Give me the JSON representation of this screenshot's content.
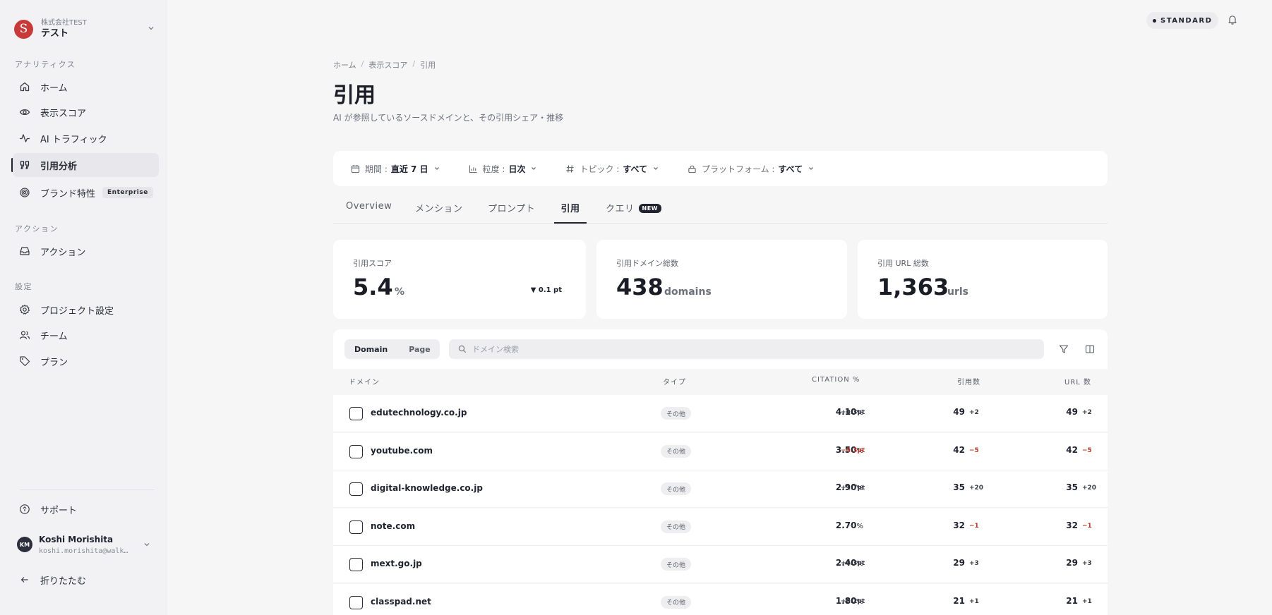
{
  "org": {
    "logo_letter": "S",
    "subtitle": "株式会社TEST",
    "name": "テスト"
  },
  "sidebar": {
    "section_analytics": "アナリティクス",
    "section_actions": "アクション",
    "section_settings": "設定",
    "items": [
      {
        "label": "ホーム",
        "icon": "home-icon"
      },
      {
        "label": "表示スコア",
        "icon": "eye-icon"
      },
      {
        "label": "AI トラフィック",
        "icon": "activity-icon"
      },
      {
        "label": "引用分析",
        "icon": "quote-icon",
        "active": true
      },
      {
        "label": "ブランド特性",
        "icon": "fingerprint-icon",
        "badge": "Enterprise"
      },
      {
        "label": "アクション",
        "icon": "inbox-icon"
      },
      {
        "label": "プロジェクト設定",
        "icon": "gear-icon"
      },
      {
        "label": "チーム",
        "icon": "users-icon"
      },
      {
        "label": "プラン",
        "icon": "tag-icon"
      }
    ],
    "support": "サポート",
    "collapse": "折りたたむ"
  },
  "user": {
    "initials": "KM",
    "name": "Koshi Morishita",
    "email": "koshi.morishita@walker"
  },
  "plan_badge": "STANDARD",
  "breadcrumb": [
    "ホーム",
    "表示スコア",
    "引用"
  ],
  "page": {
    "title": "引用",
    "description": "AI が参照しているソースドメインと、その引用シェア・推移"
  },
  "filters": [
    {
      "label": "期間 :",
      "value": "直近 7 日",
      "icon": "calendar-icon"
    },
    {
      "label": "粒度 :",
      "value": "日次",
      "icon": "chart-icon"
    },
    {
      "label": "トピック :",
      "value": "すべて",
      "icon": "hash-icon"
    },
    {
      "label": "プラットフォーム :",
      "value": "すべて",
      "icon": "lock-icon"
    }
  ],
  "tabs": [
    {
      "label": "Overview"
    },
    {
      "label": "メンション"
    },
    {
      "label": "プロンプト"
    },
    {
      "label": "引用",
      "active": true
    },
    {
      "label": "クエリ",
      "badge": "NEW"
    }
  ],
  "stats": [
    {
      "label": "引用スコア",
      "value": "5.4",
      "unit": "%",
      "delta": "▼ 0.1 pt"
    },
    {
      "label": "引用ドメイン総数",
      "value": "438",
      "unit": "domains"
    },
    {
      "label": "引用 URL 総数",
      "value": "1,363",
      "unit": "urls"
    }
  ],
  "table": {
    "segments": [
      "Domain",
      "Page"
    ],
    "search_placeholder": "ドメイン検索",
    "columns": [
      "ドメイン",
      "タイプ",
      "CITATION %",
      "引用数",
      "URL 数"
    ],
    "rows": [
      {
        "domain": "edutechnology.co.jp",
        "type": "その他",
        "citation": "4.10",
        "citation_delta": "+0.3pt",
        "cites": "49",
        "cites_delta": "+2",
        "urls": "49",
        "urls_delta": "+2"
      },
      {
        "domain": "youtube.com",
        "type": "その他",
        "citation": "3.50",
        "citation_delta": "−0.3pt",
        "cites": "42",
        "cites_delta": "−5",
        "urls": "42",
        "urls_delta": "−5"
      },
      {
        "domain": "digital-knowledge.co.jp",
        "type": "その他",
        "citation": "2.90",
        "citation_delta": "+1.7pt",
        "cites": "35",
        "cites_delta": "+20",
        "urls": "35",
        "urls_delta": "+20"
      },
      {
        "domain": "note.com",
        "type": "その他",
        "citation": "2.70",
        "citation_delta": "—",
        "cites": "32",
        "cites_delta": "−1",
        "urls": "32",
        "urls_delta": "−1"
      },
      {
        "domain": "mext.go.jp",
        "type": "その他",
        "citation": "2.40",
        "citation_delta": "+0.3pt",
        "cites": "29",
        "cites_delta": "+3",
        "urls": "29",
        "urls_delta": "+3"
      },
      {
        "domain": "classpad.net",
        "type": "その他",
        "citation": "1.80",
        "citation_delta": "+0.2pt",
        "cites": "21",
        "cites_delta": "+1",
        "urls": "21",
        "urls_delta": "+1"
      }
    ]
  },
  "colors": {
    "accent": "#1f2330",
    "negative": "#c0392b",
    "logo": "#c83a3a"
  }
}
